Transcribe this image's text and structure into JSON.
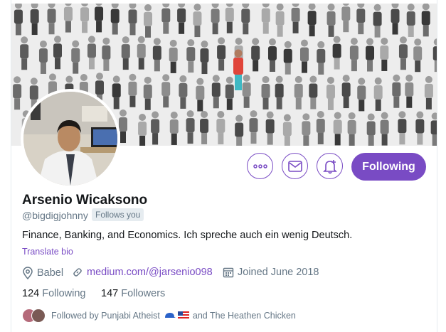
{
  "profile": {
    "name": "Arsenio Wicaksono",
    "handle": "@bigdigjohnny",
    "follows_you": "Follows you",
    "bio": "Finance, Banking, and Economics. Ich spreche auch ein wenig Deutsch.",
    "translate_bio": "Translate bio",
    "location": "Babel",
    "website": "medium.com/@jarsenio098",
    "joined": "Joined June 2018",
    "following_count": "124",
    "following_label": "Following",
    "followers_count": "147",
    "followers_label": "Followers",
    "followed_by_prefix": "Followed by Punjabi Atheist",
    "followed_by_suffix": "and The Heathen Chicken"
  },
  "actions": {
    "more_icon": "more-icon",
    "message_icon": "envelope-icon",
    "notify_icon": "bell-plus-icon",
    "follow_label": "Following"
  },
  "colors": {
    "accent": "#794bc4",
    "secondary_text": "#657786",
    "primary_text": "#14171a",
    "tag_bg": "#e6ecf0"
  }
}
